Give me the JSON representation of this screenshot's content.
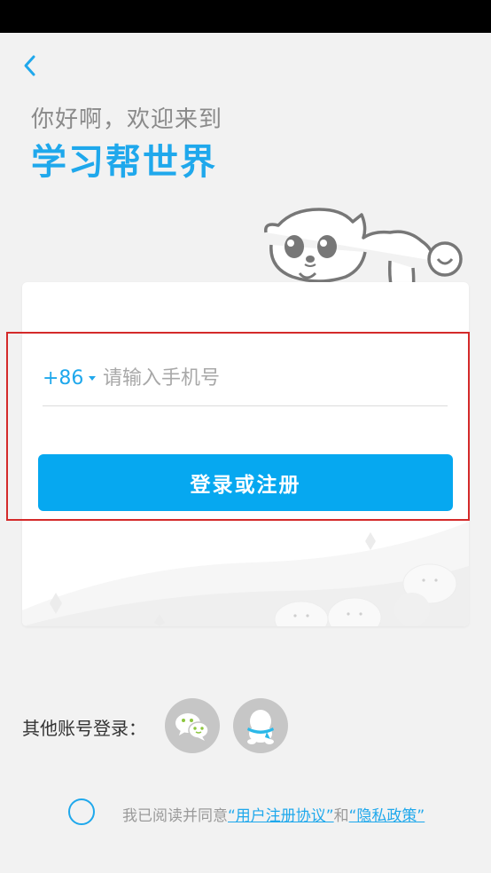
{
  "header": {
    "greeting": "你好啊，欢迎来到",
    "brand": "学习帮世界"
  },
  "login_form": {
    "country_code": "+86",
    "phone_placeholder": "请输入手机号",
    "phone_value": "",
    "submit_label": "登录或注册"
  },
  "social_login": {
    "label": "其他账号登录：",
    "options": [
      {
        "name": "wechat",
        "icon": "wechat-icon"
      },
      {
        "name": "qq",
        "icon": "qq-icon"
      }
    ]
  },
  "agreement": {
    "checked": false,
    "prefix": "我已阅读并同意",
    "user_agreement": "“用户注册协议”",
    "conjunction": "和",
    "privacy_policy": "“隐私政策”"
  },
  "colors": {
    "accent": "#1fa8ec",
    "button": "#06a8f0",
    "background": "#f2f2f2",
    "highlight": "#d42a2a"
  }
}
